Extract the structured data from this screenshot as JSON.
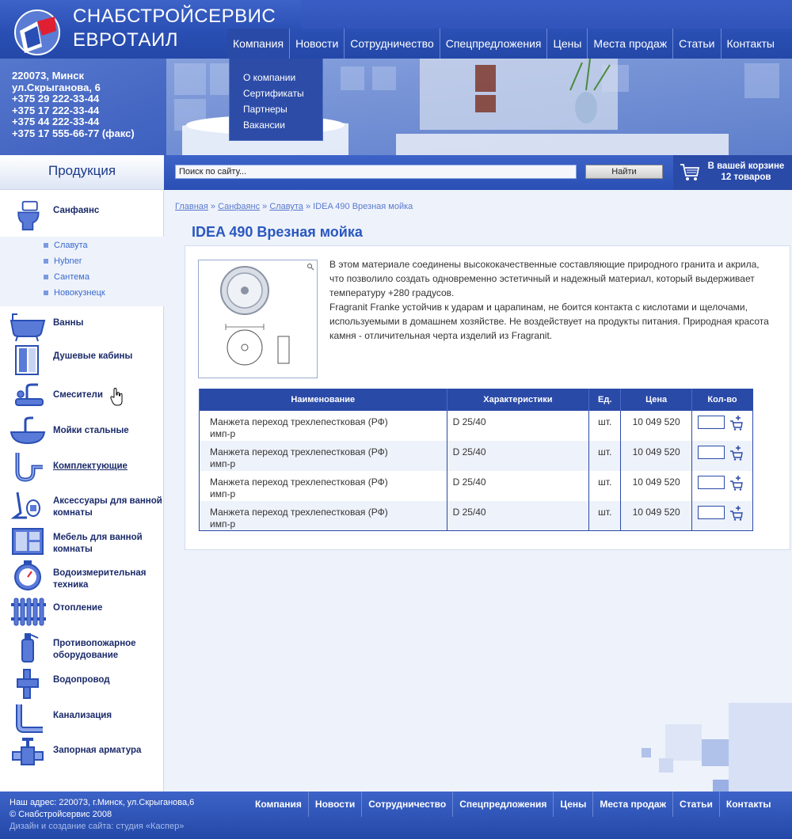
{
  "logo": {
    "line1": "СНАБСТРОЙСЕРВИС",
    "line2": "ЕВРОТАИЛ"
  },
  "nav": [
    {
      "label": "Компания"
    },
    {
      "label": "Новости"
    },
    {
      "label": "Сотрудничество"
    },
    {
      "label": "Спецпредложения"
    },
    {
      "label": "Цены"
    },
    {
      "label": "Места продаж"
    },
    {
      "label": "Статьи"
    },
    {
      "label": "Контакты"
    }
  ],
  "dropdown": [
    "О компании",
    "Сертификаты",
    "Партнеры",
    "Вакансии"
  ],
  "contact": {
    "address1": "220073, Минск",
    "address2": "ул.Скрыганова, 6",
    "phones": [
      "+375 29 222-33-44",
      "+375 17 222-33-44",
      "+375 44 222-33-44",
      "+375 17 555-66-77 (факс)"
    ]
  },
  "products_heading": "Продукция",
  "search": {
    "placeholder": "Поиск по сайту...",
    "button": "Найти"
  },
  "cart": {
    "line1": "В вашей корзине",
    "line2": "12 товаров"
  },
  "categories": [
    {
      "label": "Санфаянс",
      "icon": "toilet-icon"
    },
    {
      "label": "Ванны",
      "icon": "bathtub-icon"
    },
    {
      "label": "Душевые кабины",
      "icon": "shower-cabin-icon"
    },
    {
      "label": "Смесители",
      "icon": "faucet-icon"
    },
    {
      "label": "Мойки стальные",
      "icon": "sink-icon"
    },
    {
      "label": "Комплектующие",
      "icon": "siphon-icon"
    },
    {
      "label": "Аксессуары для ванной комнаты",
      "icon": "accessories-icon"
    },
    {
      "label": "Мебель для ванной комнаты",
      "icon": "furniture-icon"
    },
    {
      "label": "Водоизмерительная техника",
      "icon": "water-meter-icon"
    },
    {
      "label": "Отопление",
      "icon": "radiator-icon"
    },
    {
      "label": "Противопожарное оборудование",
      "icon": "fire-extinguisher-icon"
    },
    {
      "label": "Водопровод",
      "icon": "pipe-fitting-icon"
    },
    {
      "label": "Канализация",
      "icon": "sewer-pipe-icon"
    },
    {
      "label": "Запорная арматура",
      "icon": "valve-icon"
    }
  ],
  "subcategories": [
    "Славута",
    "Hybner",
    "Сантема",
    "Новокузнецк"
  ],
  "breadcrumb": {
    "home": "Главная",
    "cat": "Санфаянс",
    "sub": "Славута",
    "sep": " » ",
    "current": "IDEA 490 Врезная мойка"
  },
  "page_title": "IDEA 490 Врезная мойка",
  "description": {
    "p1": "В этом материале соединены высококачественные составляющие природного гранита и акрила, что позволило создать одновременно эстетичный и надежный материал, который выдерживает температуру +280 градусов.",
    "p2": "Fragranit Franke устойчив к ударам и царапинам, не боится контакта с кислотами и щелочами, используемыми в домашнем хозяйстве. Не воздействует на продукты питания. Природная красота камня - отличительная черта изделий из Fragranit."
  },
  "table": {
    "headers": [
      "Наименование",
      "Характеристики",
      "Ед.",
      "Цена",
      "Кол-во"
    ],
    "rows": [
      {
        "name": "Манжета переход трехлепестковая (РФ) имп-р",
        "spec": "D 25/40",
        "unit": "шт.",
        "price": "10 049 520"
      },
      {
        "name": "Манжета переход трехлепестковая (РФ) имп-р",
        "spec": "D 25/40",
        "unit": "шт.",
        "price": "10 049 520"
      },
      {
        "name": "Манжета переход трехлепестковая (РФ) имп-р",
        "spec": "D 25/40",
        "unit": "шт.",
        "price": "10 049 520"
      },
      {
        "name": "Манжета переход трехлепестковая (РФ) имп-р",
        "spec": "D 25/40",
        "unit": "шт.",
        "price": "10 049 520"
      }
    ]
  },
  "footer": {
    "address": "Наш адрес: 220073, г.Минск, ул.Скрыганова,6",
    "copyright": "© Снабстройсервис 2008",
    "credit": "Дизайн и создание сайта: студия «Каспер»"
  },
  "colors": {
    "primary": "#2a4fb4",
    "accent": "#2a58c0",
    "link": "#3a6ad0",
    "logo_red": "#e02030"
  }
}
